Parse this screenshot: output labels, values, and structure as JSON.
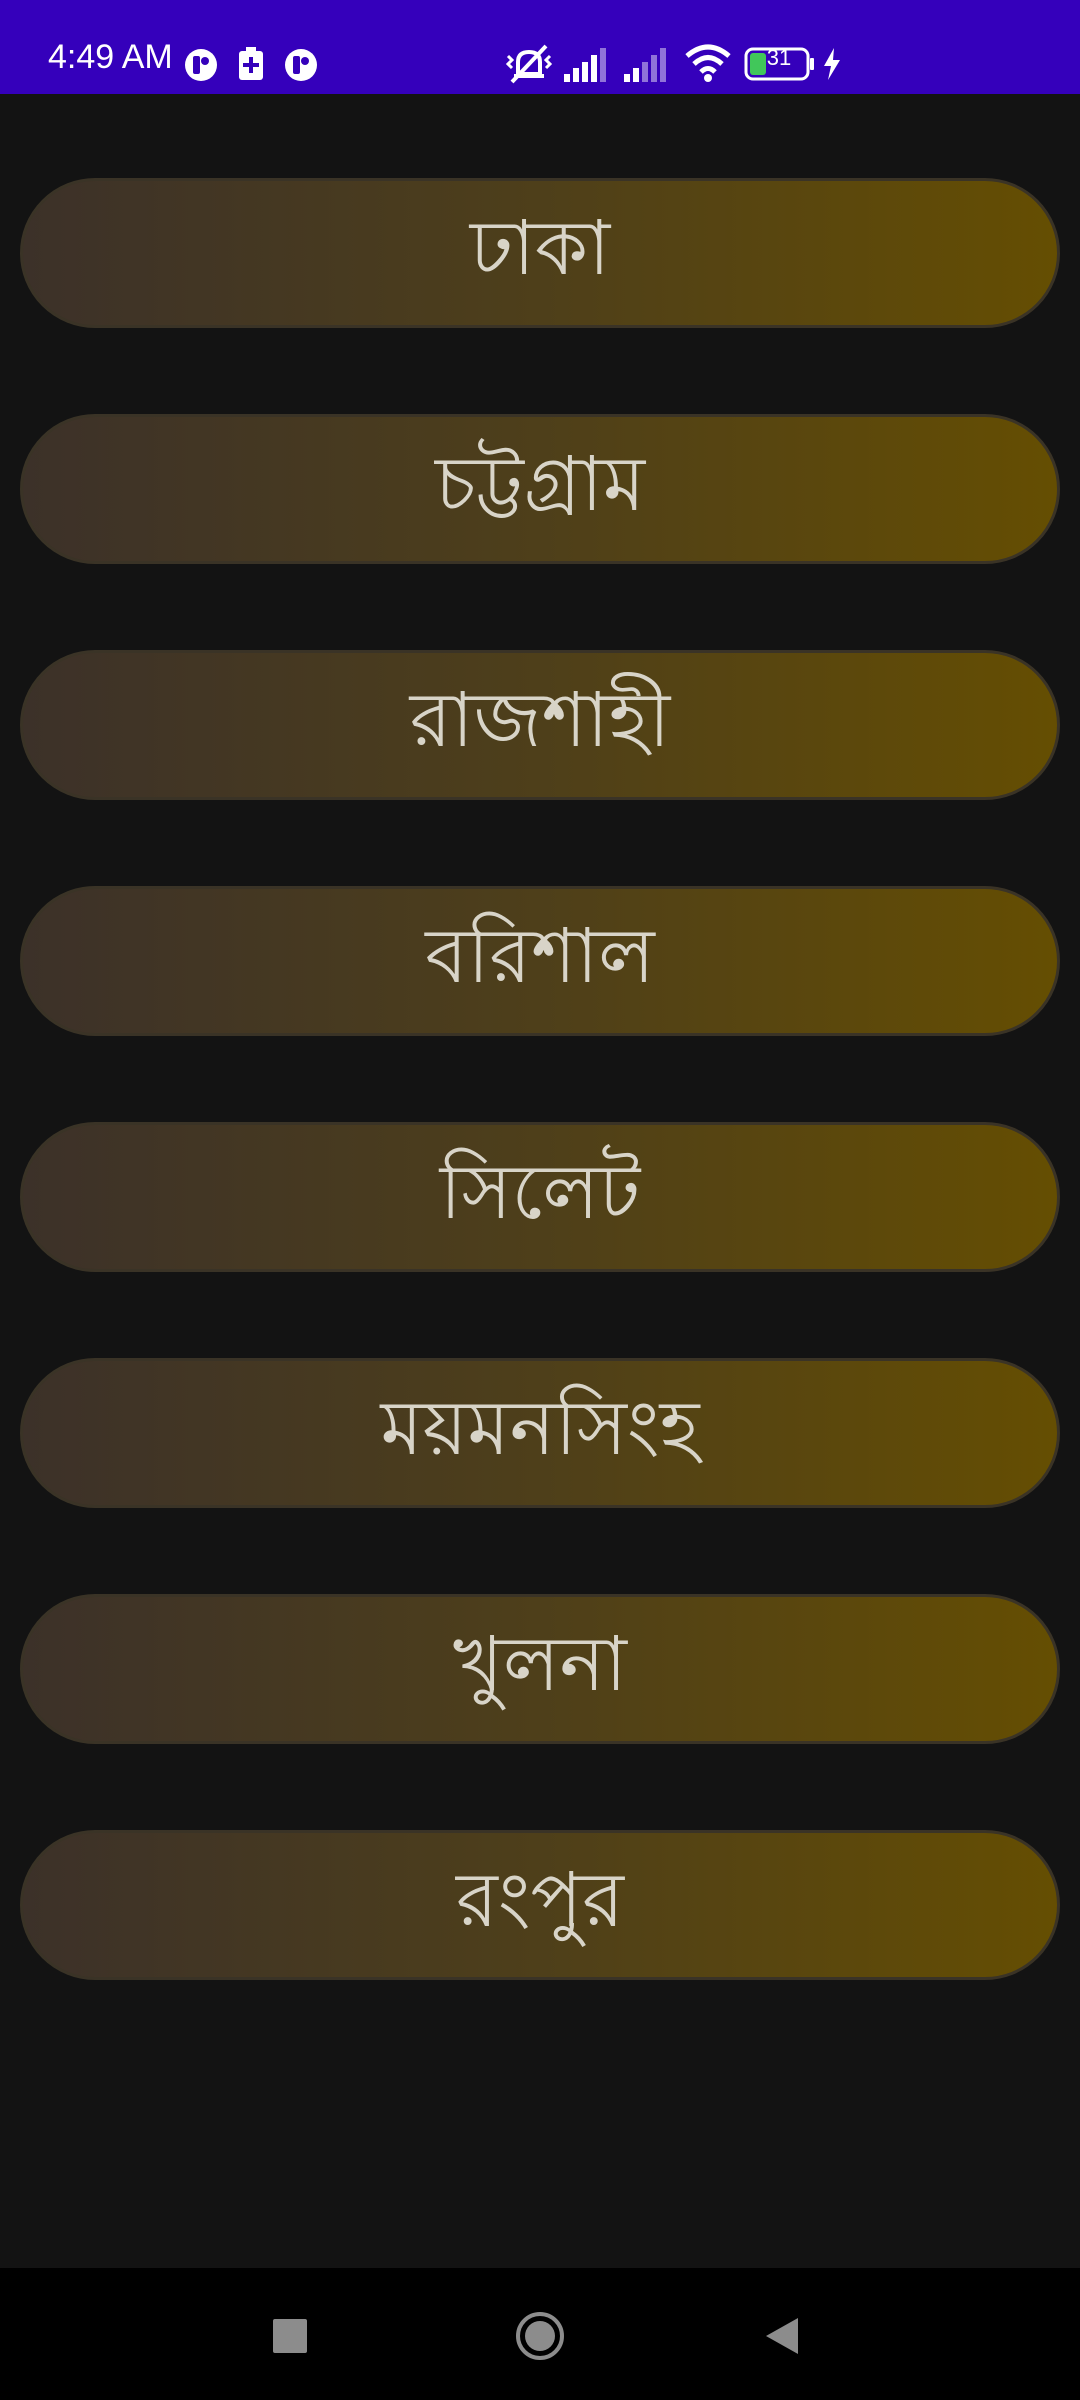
{
  "status_bar": {
    "time": "4:49 AM",
    "battery_level": "31",
    "icons": [
      "app-notification-icon",
      "battery-saver-icon",
      "app-notification-icon",
      "vibrate-off-icon",
      "cell-signal-icon",
      "cell-signal-icon",
      "wifi-icon",
      "battery-icon",
      "charging-icon"
    ],
    "colors": {
      "background": "#3500bb",
      "foreground": "#ffffff",
      "battery_fill": "#41c75a"
    }
  },
  "cities": [
    {
      "label": "ঢাকা"
    },
    {
      "label": "চট্টগ্রাম"
    },
    {
      "label": "রাজশাহী"
    },
    {
      "label": "বরিশাল"
    },
    {
      "label": "সিলেট"
    },
    {
      "label": "ময়মনসিংহ"
    },
    {
      "label": "খুলনা"
    },
    {
      "label": "রংপুর"
    }
  ],
  "theme": {
    "page_background": "#131313",
    "button_gradient": [
      "#3c3129",
      "#654e02"
    ],
    "button_text": "#d8d4c8"
  },
  "nav_bar": {
    "buttons": [
      "recents-square-icon",
      "home-circle-icon",
      "back-triangle-icon"
    ]
  }
}
